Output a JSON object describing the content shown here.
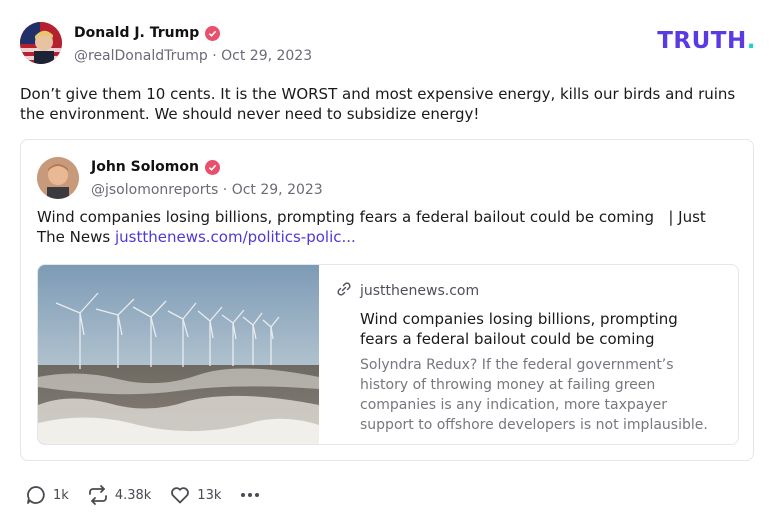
{
  "post": {
    "author": {
      "display_name": "Donald J. Trump",
      "handle": "@realDonaldTrump",
      "date": "Oct 29, 2023",
      "separator": "·"
    },
    "brand": {
      "text": "TRUTH",
      "dot": "."
    },
    "text": "Don’t give them 10 cents. It is the WORST and most expensive energy, kills our birds and ruins the environment. We should never need to subsidize energy!",
    "quoted": {
      "author": {
        "display_name": "John Solomon",
        "handle": "@jsolomonreports",
        "date": "Oct 29, 2023",
        "separator": "·"
      },
      "text": "Wind companies losing billions, prompting fears a federal bailout could be coming   | Just The News",
      "link_text": "justthenews.com/politics-polic...",
      "card": {
        "domain": "justthenews.com",
        "title": "Wind companies losing billions, prompting fears a federal bailout could be coming",
        "description": "Solyndra Redux? If the federal government’s history of throwing money at failing green companies is any indication, more taxpayer support to offshore developers is not implausible."
      }
    },
    "actions": {
      "replies": "1k",
      "retruths": "4.38k",
      "likes": "13k"
    }
  },
  "colors": {
    "brand": "#5a3be2",
    "brand_dot": "#1fd3c9",
    "link": "#4d38d8",
    "verified": "#e8506b"
  },
  "icons": [
    "verified-badge-icon",
    "link-icon",
    "reply-icon",
    "retruth-icon",
    "heart-icon",
    "more-icon"
  ]
}
